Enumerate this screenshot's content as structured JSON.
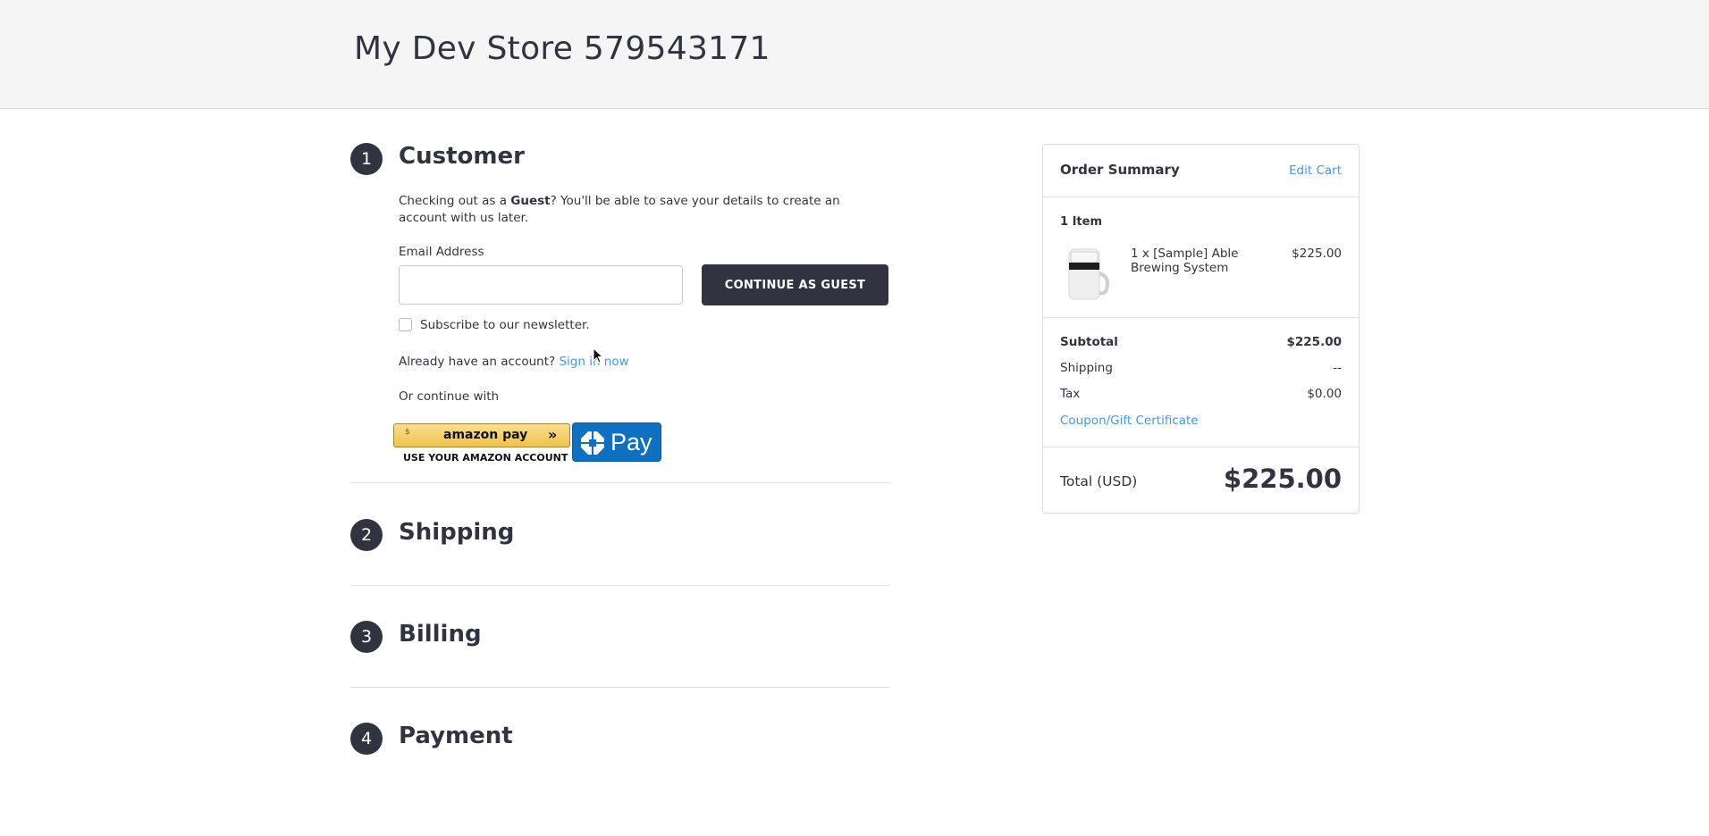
{
  "store": {
    "title": "My Dev Store 579543171"
  },
  "steps": [
    {
      "number": "1",
      "title": "Customer"
    },
    {
      "number": "2",
      "title": "Shipping"
    },
    {
      "number": "3",
      "title": "Billing"
    },
    {
      "number": "4",
      "title": "Payment"
    }
  ],
  "customer": {
    "intro_prefix": "Checking out as a ",
    "intro_bold": "Guest",
    "intro_suffix": "? You'll be able to save your details to create an account with us later.",
    "email_label": "Email Address",
    "email_value": "",
    "email_placeholder": "",
    "continue_label": "CONTINUE AS GUEST",
    "newsletter_label": "Subscribe to our newsletter.",
    "newsletter_checked": false,
    "account_prompt": "Already have an account?",
    "signin_label": "Sign in now",
    "or_continue": "Or continue with",
    "amazon_button": "amazon pay",
    "amazon_sub": "USE YOUR AMAZON ACCOUNT",
    "chase_button": "Pay"
  },
  "summary": {
    "title": "Order Summary",
    "edit_cart": "Edit Cart",
    "item_count": "1 Item",
    "items": [
      {
        "name": "1 x [Sample] Able Brewing System",
        "price": "$225.00",
        "image": "brewing-system-image"
      }
    ],
    "subtotal_label": "Subtotal",
    "subtotal_value": "$225.00",
    "shipping_label": "Shipping",
    "shipping_value": "--",
    "tax_label": "Tax",
    "tax_value": "$0.00",
    "coupon_label": "Coupon/Gift Certificate",
    "total_label": "Total (USD)",
    "total_value": "$225.00"
  },
  "colors": {
    "accent_link": "#4496f6",
    "dark": "#313440",
    "chase_blue": "#0f6fc1",
    "amazon_gold": "#f0c14b"
  }
}
